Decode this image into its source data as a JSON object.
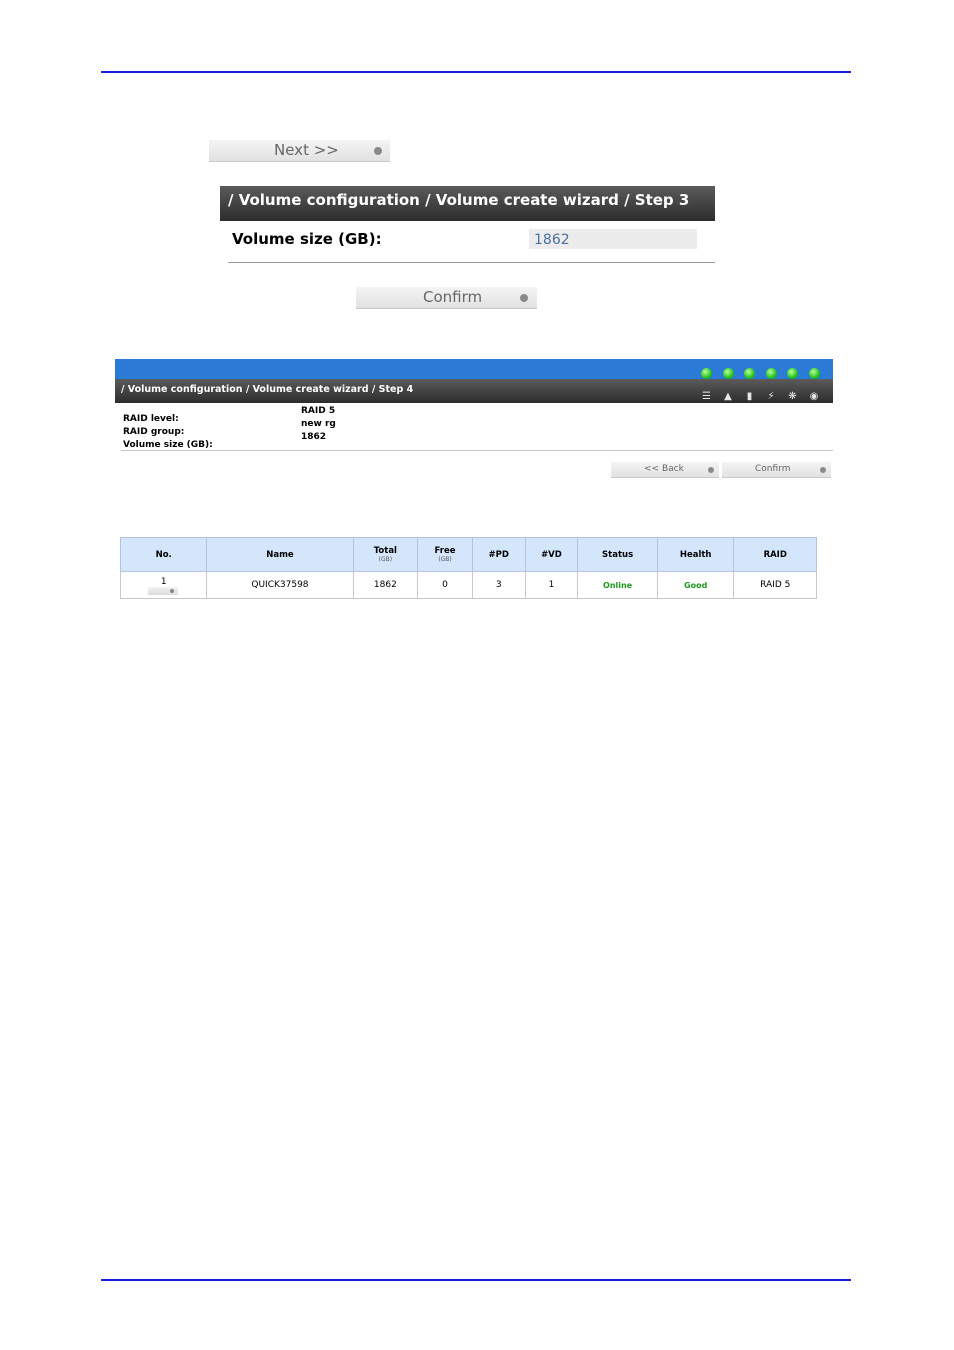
{
  "step3": {
    "next_label": "Next >>",
    "breadcrumb": "/ Volume configuration / Volume create wizard / Step 3",
    "volume_size_label": "Volume size (GB):",
    "volume_size_value": "1862",
    "confirm_label": "Confirm"
  },
  "step4": {
    "breadcrumb": "/ Volume configuration / Volume create wizard / Step 4",
    "status_icons": [
      "database-icon",
      "thermometer-icon",
      "battery-icon",
      "power-supply-icon",
      "fan-icon",
      "ups-icon"
    ],
    "summary": [
      {
        "label": "RAID level:",
        "value": "RAID 5"
      },
      {
        "label": "RAID group:",
        "value": "new rg"
      },
      {
        "label": "Volume size (GB):",
        "value": "1862"
      }
    ],
    "back_label": "<< Back",
    "confirm_label": "Confirm"
  },
  "volume_table": {
    "headers": {
      "no": "No.",
      "name": "Name",
      "total": "Total",
      "total_unit": "(GB)",
      "free": "Free",
      "free_unit": "(GB)",
      "pd": "#PD",
      "vd": "#VD",
      "status": "Status",
      "health": "Health",
      "raid": "RAID"
    },
    "rows": [
      {
        "no": "1",
        "name": "QUICK37598",
        "total": "1862",
        "free": "0",
        "pd": "3",
        "vd": "1",
        "status": "Online",
        "health": "Good",
        "raid": "RAID 5"
      }
    ]
  },
  "colors": {
    "rule": "#1a1adc",
    "accent_blue": "#2b7ad6",
    "ok_green": "#1e9a1e",
    "header_blue": "#d3e6fb"
  }
}
